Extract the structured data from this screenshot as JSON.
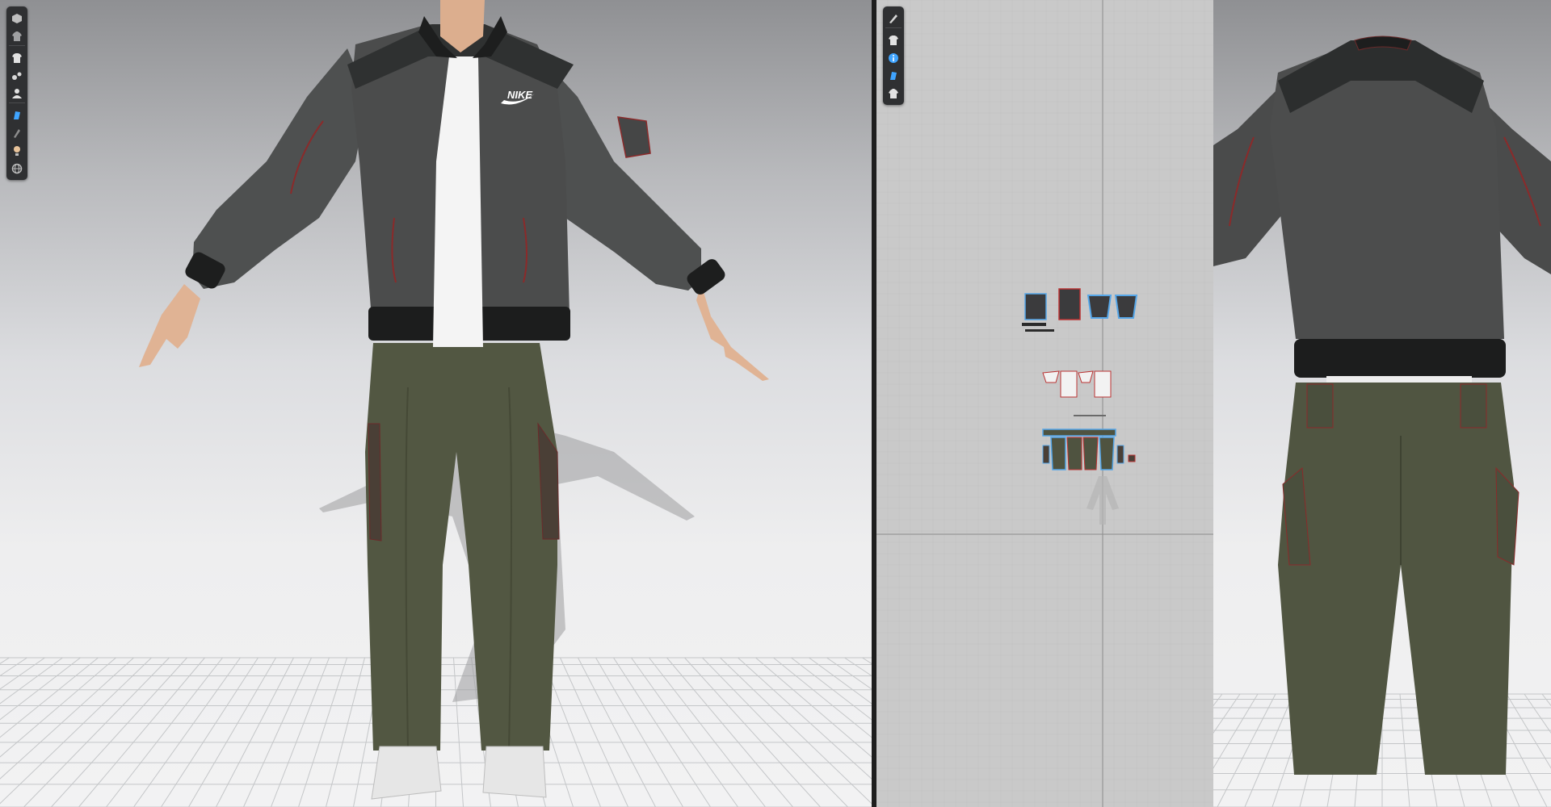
{
  "app": {
    "layout": [
      "3d-garment-window-front",
      "2d-pattern-window",
      "3d-garment-window-back"
    ]
  },
  "toolbar_3d": {
    "groups": [
      [
        "cube-icon",
        "garment-icon"
      ],
      [
        "tshirt-icon",
        "pins-icon",
        "avatar-icon"
      ],
      [
        "texture-icon",
        "brush-icon",
        "light-icon",
        "sphere-icon"
      ]
    ]
  },
  "toolbar_2d": {
    "groups": [
      [
        "pen-icon"
      ],
      [
        "tshirt-icon",
        "info-icon",
        "texture-icon",
        "garment-icon"
      ]
    ]
  },
  "garment": {
    "logo_text": "NIKE",
    "jacket_color": "#4c4d4d",
    "jacket_yoke_color": "#2f3131",
    "rib_color": "#1c1d1d",
    "stitch_color": "#8b2a2a",
    "tee_color": "#f4f4f4",
    "pants_color": "#4f5340",
    "pocket_color": "#4a3f36",
    "shoe_color": "#e6e6e6",
    "skin_color": "#e2b596"
  },
  "colors": {
    "toolbar_bg": "#2f3032",
    "icon_active": "#3fa4ff",
    "icon_default": "#d8d8d8",
    "pattern_highlight": "#55a6e8"
  }
}
